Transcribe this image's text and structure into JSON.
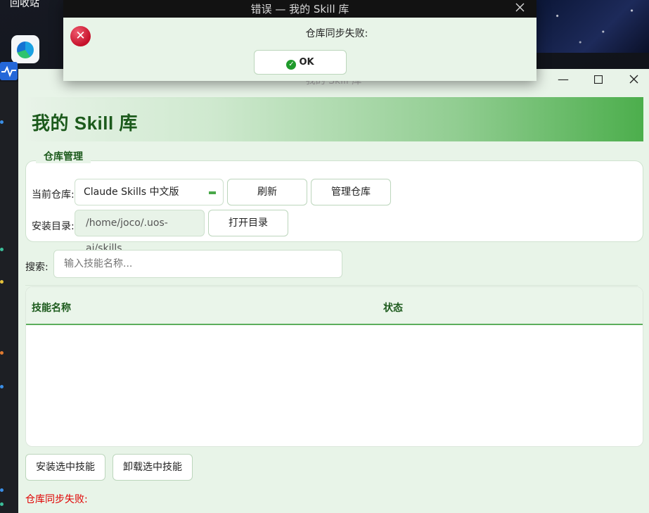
{
  "desktop": {
    "icon_label": "回收站"
  },
  "main_window": {
    "title": "我的 Skill 库",
    "header_title": "我的 Skill 库",
    "repo_group_title": "仓库管理",
    "current_repo_label": "当前仓库:",
    "current_repo_value": "Claude Skills 中文版",
    "refresh_button": "刷新",
    "manage_repo_button": "管理仓库",
    "install_dir_label": "安装目录:",
    "install_dir_value": "/home/joco/.uos-ai/skills",
    "open_dir_button": "打开目录",
    "search_label": "搜索:",
    "search_placeholder": "输入技能名称...",
    "table_columns": [
      "技能名称",
      "状态"
    ],
    "table_rows": [],
    "install_button": "安装选中技能",
    "uninstall_button": "卸载选中技能",
    "status_message": "仓库同步失败:"
  },
  "error_dialog": {
    "title": "错误 — 我的 Skill 库",
    "message": "仓库同步失败:",
    "ok_button": "OK"
  }
}
